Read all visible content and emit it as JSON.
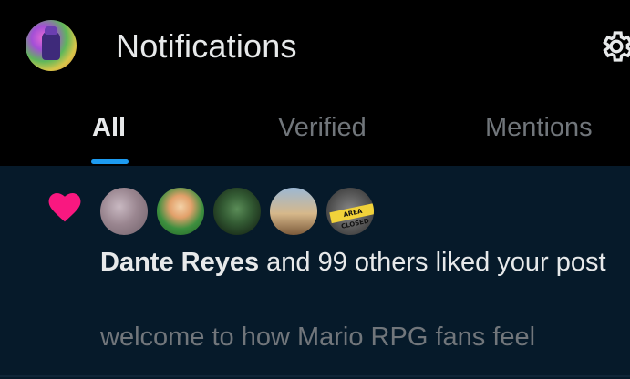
{
  "header": {
    "title": "Notifications",
    "icons": {
      "avatar": "user-avatar",
      "settings": "gear-icon"
    }
  },
  "tabs": [
    {
      "label": "All",
      "active": true
    },
    {
      "label": "Verified",
      "active": false
    },
    {
      "label": "Mentions",
      "active": false
    }
  ],
  "notification": {
    "type": "like",
    "icon": "heart-icon",
    "name": "Dante Reyes",
    "message": " and 99 others liked your post",
    "snippet": "welcome to how Mario RPG fans feel",
    "avatar_tape_text": "AREA CLOSED"
  },
  "colors": {
    "background": "#000000",
    "feed_background": "#061a2a",
    "accent": "#1d9bf0",
    "heart": "#f91880",
    "text_primary": "#e7e9ea",
    "text_secondary": "#71767b"
  }
}
